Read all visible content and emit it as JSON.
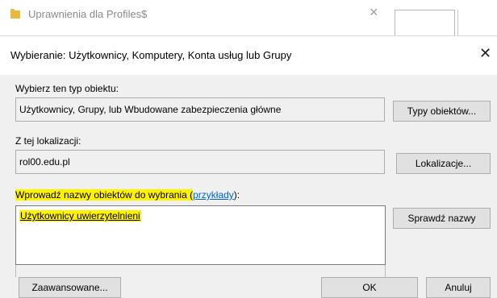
{
  "background_window": {
    "title": "Uprawnienia dla Profiles$",
    "close": "×"
  },
  "dialog": {
    "title": "Wybieranie: Użytkownicy, Komputery, Konta usług lub Grupy",
    "close": "✕",
    "object_type": {
      "label": "Wybierz ten typ obiektu:",
      "value": "Użytkownicy, Grupy, lub Wbudowane zabezpieczenia główne",
      "button": "Typy obiektów..."
    },
    "location": {
      "label": "Z tej lokalizacji:",
      "value": "rol00.edu.pl",
      "button": "Lokalizacje..."
    },
    "names": {
      "label_prefix": "Wprowadź nazwy obiektów do wybrania (",
      "label_link": "przykłady",
      "label_suffix": "):",
      "entry": "Użytkownicy uwierzytelnieni",
      "button": "Sprawdź nazwy"
    },
    "buttons": {
      "advanced": "Zaawansowane...",
      "ok": "OK",
      "cancel": "Anuluj"
    }
  }
}
